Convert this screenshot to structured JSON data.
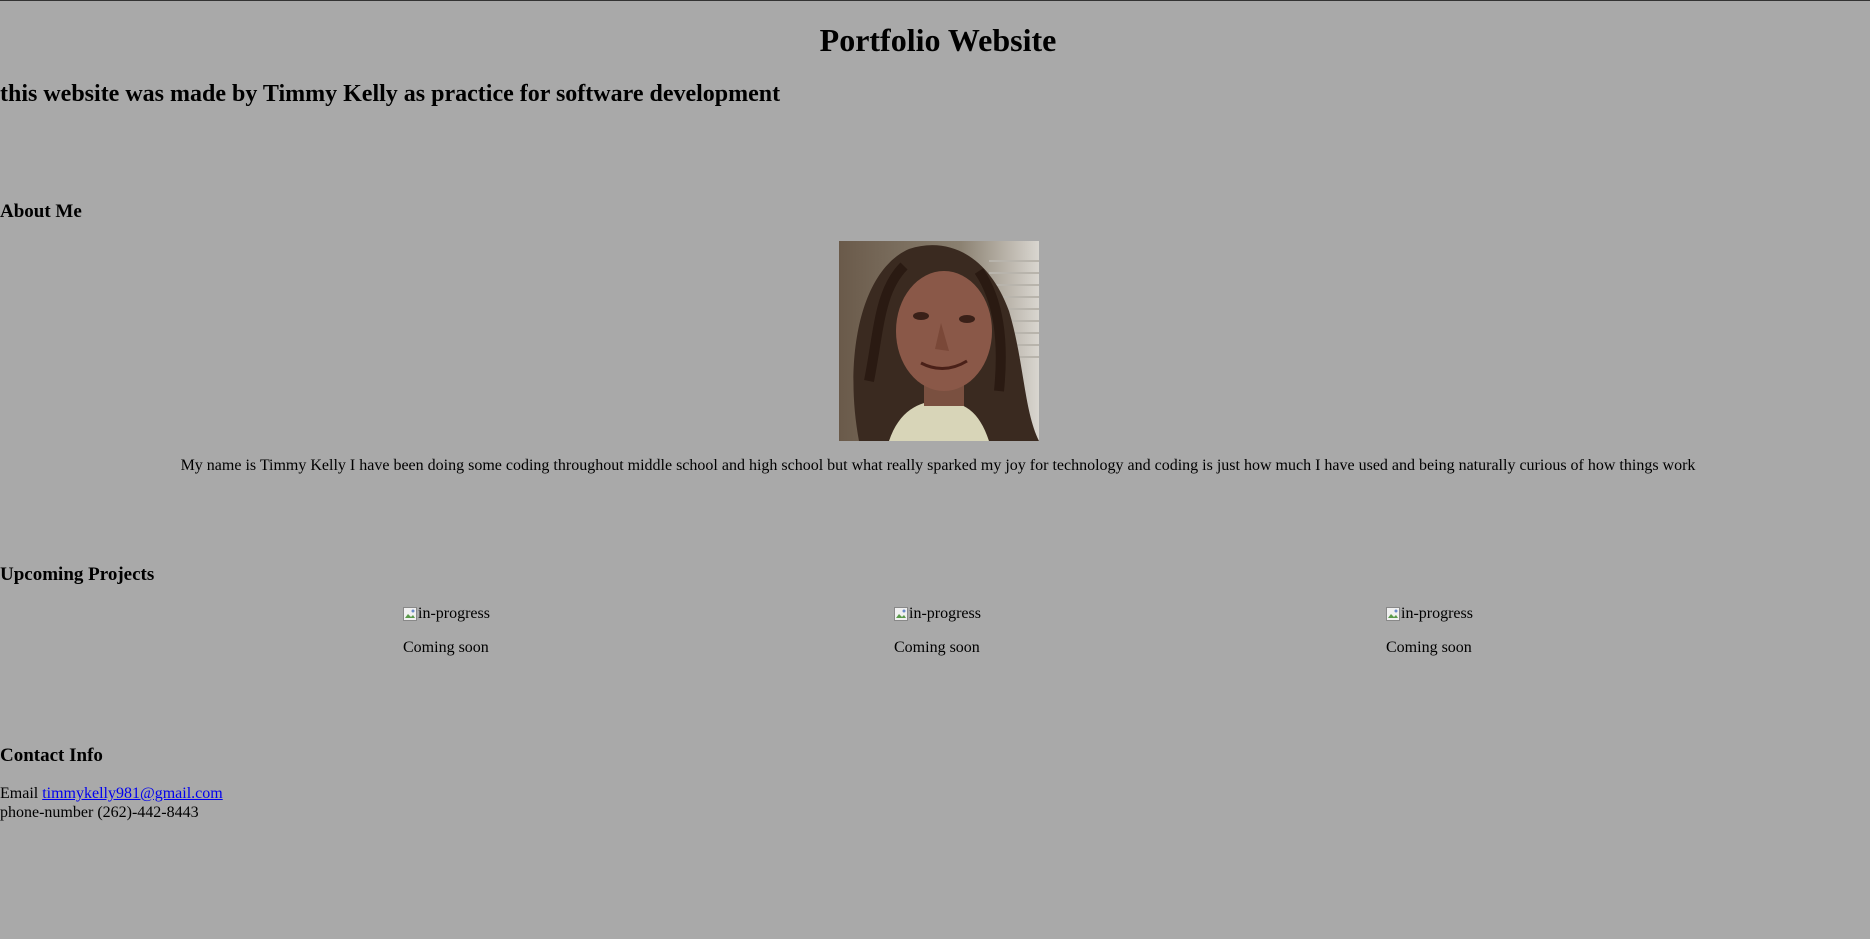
{
  "header": {
    "title": "Portfolio Website",
    "subtitle": "this website was made by Timmy Kelly as practice for software development"
  },
  "about": {
    "heading": "About Me",
    "text": "My name is Timmy Kelly I have been doing some coding throughout middle school and high school but what really sparked my joy for technology and coding is just how much I have used and being naturally curious of how things work"
  },
  "projects": {
    "heading": "Upcoming Projects",
    "items": [
      {
        "img_alt": "in-progress",
        "caption": "Coming soon"
      },
      {
        "img_alt": "in-progress",
        "caption": "Coming soon"
      },
      {
        "img_alt": "in-progress",
        "caption": "Coming soon"
      }
    ]
  },
  "contact": {
    "heading": "Contact Info",
    "email_label": "Email",
    "email": "timmykelly981@gmail.com",
    "phone_label": "phone-number",
    "phone": "(262)-442-8443"
  },
  "colors": {
    "background": "#a9a9a9",
    "link": "#0000ee"
  }
}
